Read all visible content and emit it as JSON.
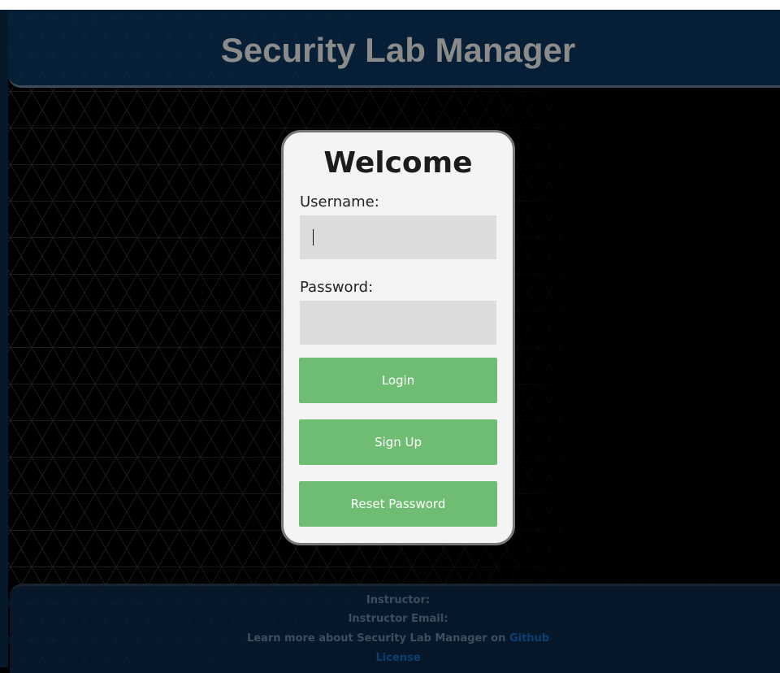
{
  "header": {
    "title": "Security Lab Manager"
  },
  "login_card": {
    "title": "Welcome",
    "username_label": "Username:",
    "username_value": "",
    "password_label": "Password:",
    "password_value": "",
    "login_button": "Login",
    "signup_button": "Sign Up",
    "reset_button": "Reset Password"
  },
  "footer": {
    "instructor_label": "Instructor:",
    "instructor_email_label": "Instructor Email:",
    "learn_more_text": "Learn more about Security Lab Manager on",
    "github_link": "Github",
    "license_link": "License"
  },
  "colors": {
    "background": "#000000",
    "header_bg": "#082642",
    "title_text": "#8b8b8b",
    "card_bg": "#f4f4f4",
    "button_green": "#6fbd72",
    "footer_text": "#3e4e5e",
    "footer_link": "#0a3f74"
  }
}
